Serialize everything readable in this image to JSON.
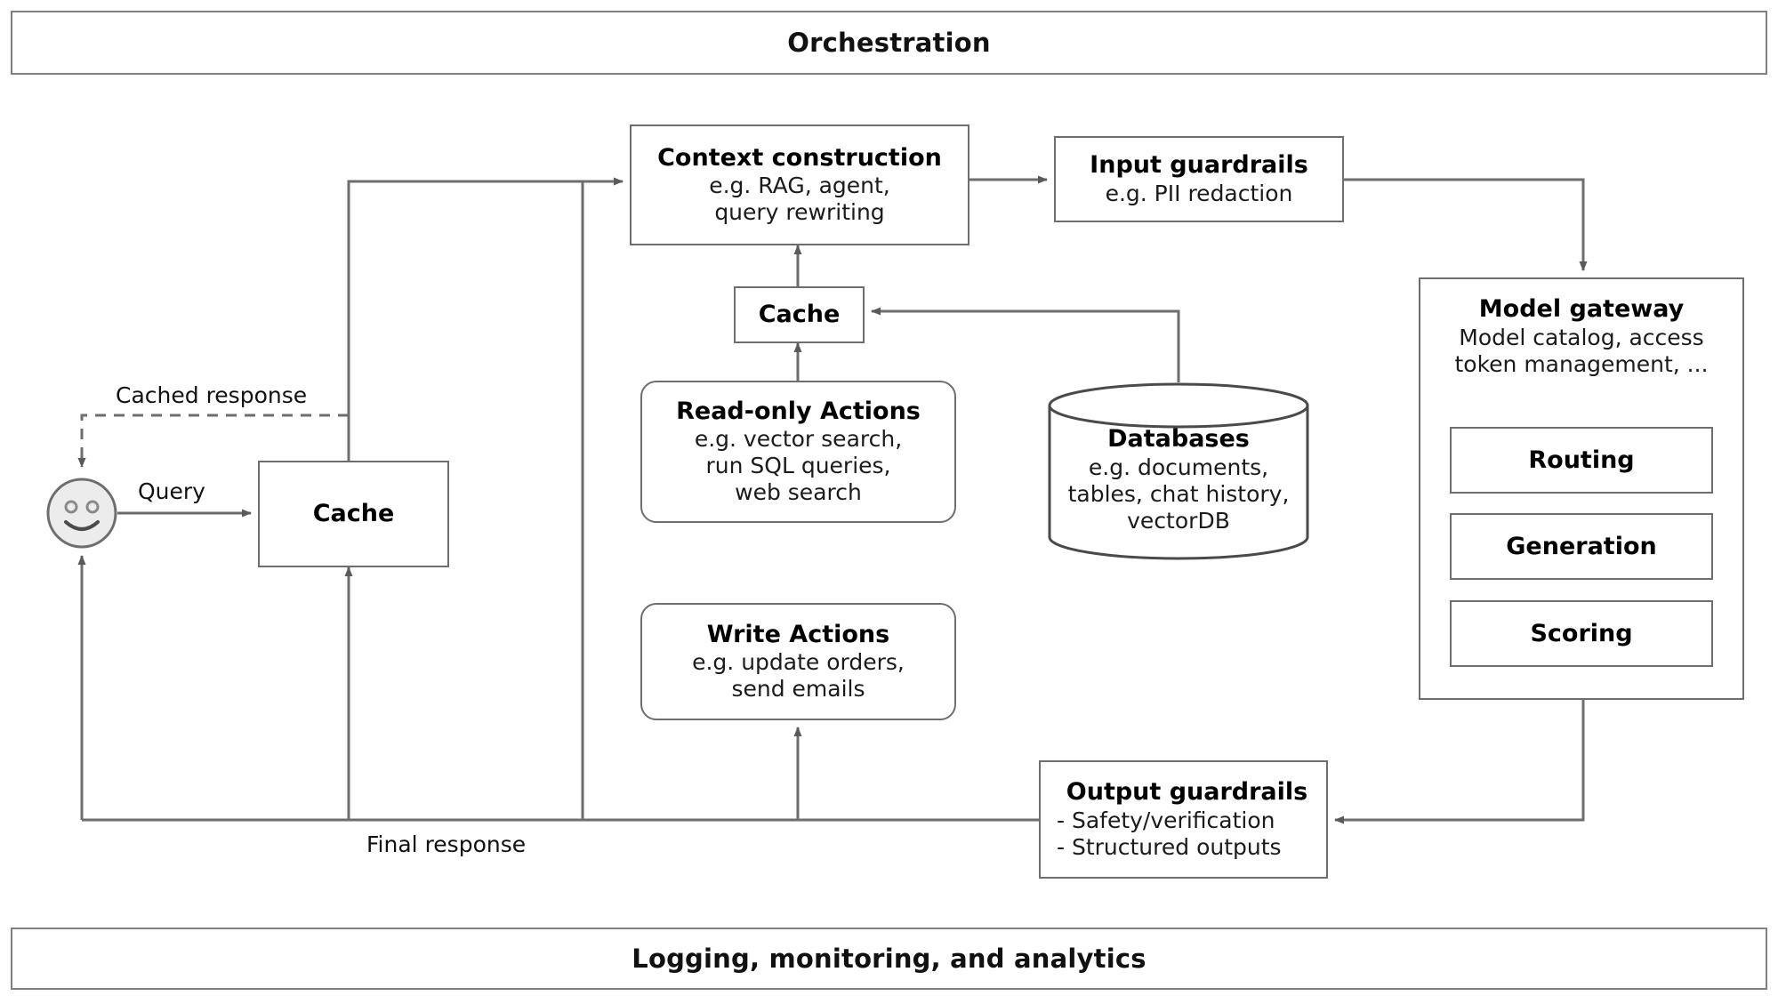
{
  "bands": {
    "top": {
      "label": "Orchestration"
    },
    "bottom": {
      "label": "Logging, monitoring, and analytics"
    }
  },
  "nodes": {
    "context_construction": {
      "title": "Context construction",
      "sub_line1": "e.g. RAG, agent,",
      "sub_line2": "query rewriting"
    },
    "input_guardrails": {
      "title": "Input guardrails",
      "sub_line1": "e.g. PII redaction"
    },
    "model_gateway": {
      "title": "Model gateway",
      "sub_line1": "Model catalog, access",
      "sub_line2": "token management, ...",
      "children": [
        {
          "label": "Routing"
        },
        {
          "label": "Generation"
        },
        {
          "label": "Scoring"
        }
      ]
    },
    "cache_mid": {
      "title": "Cache"
    },
    "cache_left": {
      "title": "Cache"
    },
    "read_only_actions": {
      "title": "Read-only Actions",
      "sub_line1": "e.g. vector search,",
      "sub_line2": "run SQL queries,",
      "sub_line3": "web search"
    },
    "write_actions": {
      "title": "Write Actions",
      "sub_line1": "e.g. update orders,",
      "sub_line2": "send emails"
    },
    "databases": {
      "title": "Databases",
      "sub_line1": "e.g. documents,",
      "sub_line2": "tables, chat history,",
      "sub_line3": "vectorDB"
    },
    "output_guardrails": {
      "title": "Output guardrails",
      "sub_line1": "- Safety/verification",
      "sub_line2": "- Structured outputs"
    },
    "user": {
      "name": "user-face-icon"
    }
  },
  "edge_labels": {
    "cached_response": "Cached response",
    "query": "Query",
    "final_response": "Final response"
  },
  "colors": {
    "stroke": "#6e6e6e",
    "band_stroke": "#808080",
    "face_fill": "#ececec",
    "text": "#000000",
    "background": "#ffffff"
  }
}
